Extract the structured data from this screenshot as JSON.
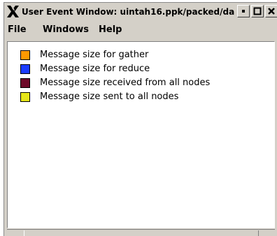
{
  "window": {
    "title": "User Event Window: uintah16.ppk/packed/da"
  },
  "menubar": {
    "items": [
      {
        "label": "File"
      },
      {
        "label": "Windows"
      },
      {
        "label": "Help"
      }
    ]
  },
  "legend": {
    "items": [
      {
        "label": "Message size for gather",
        "color": "#ff9900"
      },
      {
        "label": "Message size for reduce",
        "color": "#1a3cff"
      },
      {
        "label": "Message size received from all nodes",
        "color": "#6e0a2a"
      },
      {
        "label": "Message size sent to all nodes",
        "color": "#e6e619"
      }
    ]
  }
}
